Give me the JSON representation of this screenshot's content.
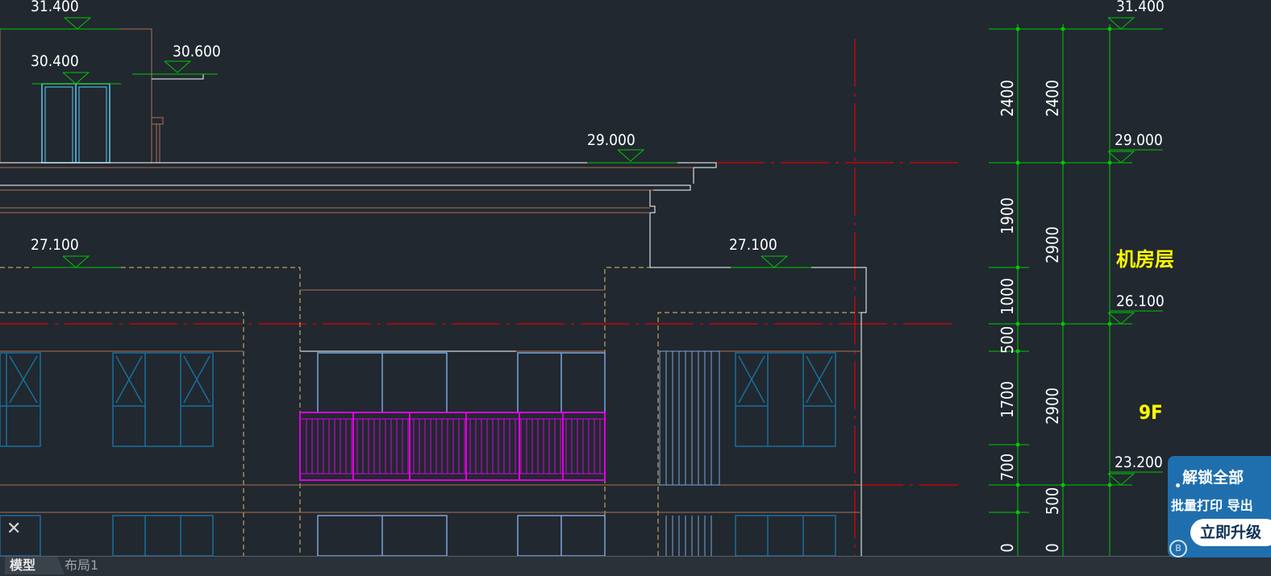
{
  "tabs": {
    "model": "模型",
    "layout": "布局1"
  },
  "elevations": {
    "top_left": "31.400",
    "top_right": "31.400",
    "door_level": "30.400",
    "parapet": "30.600",
    "roof_edge": "29.000",
    "right_29": "29.000",
    "left_27": "27.100",
    "mid_27": "27.100",
    "right_26": "26.100",
    "right_23": "23.200"
  },
  "dims_col1": [
    "2400",
    "1900",
    "1000",
    "500",
    "1700",
    "700",
    "0"
  ],
  "dims_col2": [
    "2400",
    "2900",
    "2900",
    "500",
    "0"
  ],
  "floor_labels": {
    "machine_room": "机房层",
    "nine_f": "9F"
  },
  "promo": {
    "title": "解锁全部",
    "subtitle": "批量打印 导出",
    "button": "立即升级"
  },
  "icons": {
    "close": "close-icon",
    "badge": "info-badge-icon"
  },
  "colors": {
    "background": "#212830",
    "dim": "#00c800",
    "axis": "#e00000",
    "wall": "#b07050",
    "window": "#1a6f9a",
    "railing": "#e000e0",
    "outline": "#e0c060",
    "label": "#ffff00"
  }
}
